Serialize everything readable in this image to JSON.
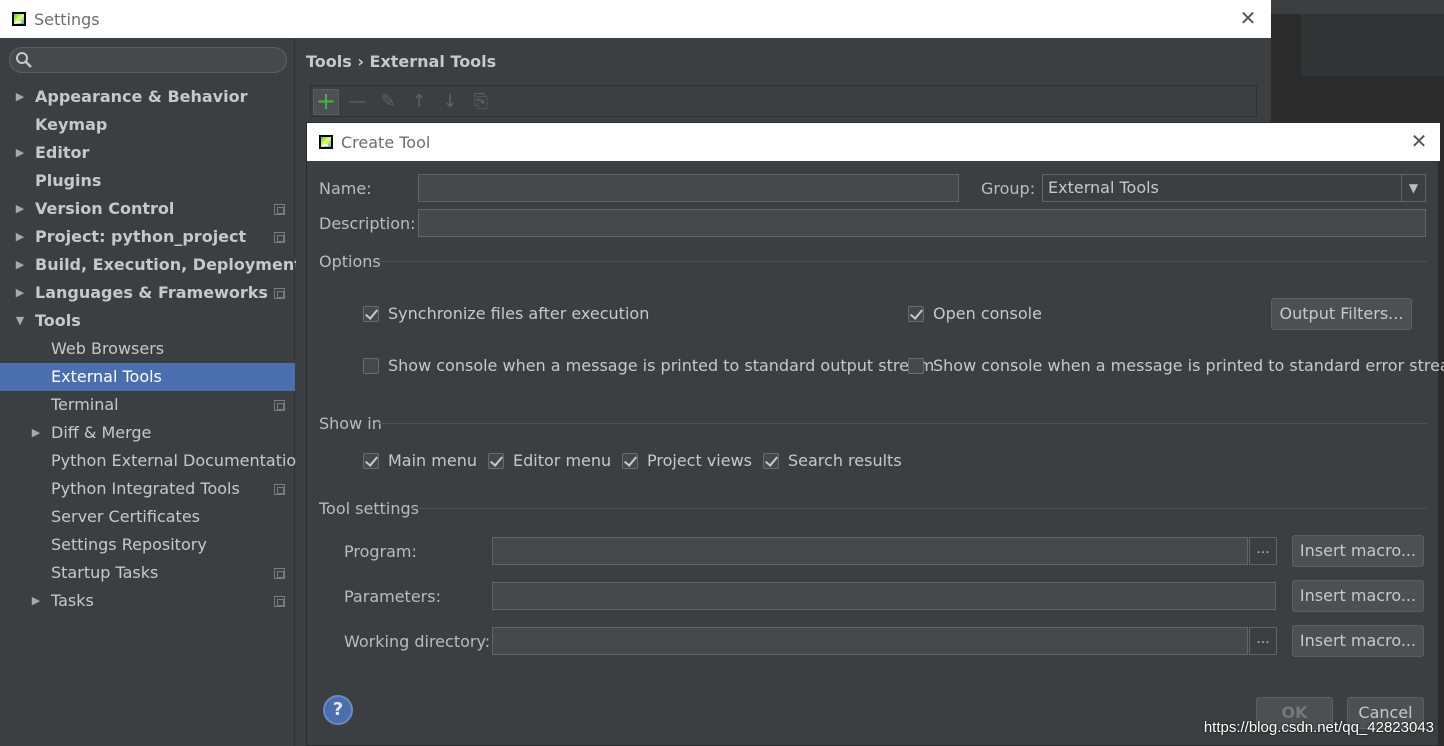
{
  "settings": {
    "title": "Settings",
    "breadcrumb": "Tools › External Tools",
    "sidebar": [
      {
        "label": "Appearance & Behavior",
        "bold": true,
        "arrow": "right",
        "level": 0,
        "icon": false
      },
      {
        "label": "Keymap",
        "bold": true,
        "arrow": "",
        "level": 0,
        "icon": false
      },
      {
        "label": "Editor",
        "bold": true,
        "arrow": "right",
        "level": 0,
        "icon": false
      },
      {
        "label": "Plugins",
        "bold": true,
        "arrow": "",
        "level": 0,
        "icon": false
      },
      {
        "label": "Version Control",
        "bold": true,
        "arrow": "right",
        "level": 0,
        "icon": true
      },
      {
        "label": "Project: python_project",
        "bold": true,
        "arrow": "right",
        "level": 0,
        "icon": true
      },
      {
        "label": "Build, Execution, Deployment",
        "bold": true,
        "arrow": "right",
        "level": 0,
        "icon": false
      },
      {
        "label": "Languages & Frameworks",
        "bold": true,
        "arrow": "right",
        "level": 0,
        "icon": true
      },
      {
        "label": "Tools",
        "bold": true,
        "arrow": "down",
        "level": 0,
        "icon": false
      },
      {
        "label": "Web Browsers",
        "bold": false,
        "arrow": "",
        "level": 1,
        "icon": false
      },
      {
        "label": "External Tools",
        "bold": false,
        "arrow": "",
        "level": 1,
        "icon": false,
        "selected": true
      },
      {
        "label": "Terminal",
        "bold": false,
        "arrow": "",
        "level": 1,
        "icon": true
      },
      {
        "label": "Diff & Merge",
        "bold": false,
        "arrow": "right",
        "level": 1,
        "icon": false
      },
      {
        "label": "Python External Documentation",
        "bold": false,
        "arrow": "",
        "level": 1,
        "icon": false
      },
      {
        "label": "Python Integrated Tools",
        "bold": false,
        "arrow": "",
        "level": 1,
        "icon": true
      },
      {
        "label": "Server Certificates",
        "bold": false,
        "arrow": "",
        "level": 1,
        "icon": false
      },
      {
        "label": "Settings Repository",
        "bold": false,
        "arrow": "",
        "level": 1,
        "icon": false
      },
      {
        "label": "Startup Tasks",
        "bold": false,
        "arrow": "",
        "level": 1,
        "icon": true
      },
      {
        "label": "Tasks",
        "bold": false,
        "arrow": "right",
        "level": 1,
        "icon": true
      }
    ]
  },
  "dialog": {
    "title": "Create Tool",
    "name_label": "Name:",
    "name_value": "",
    "group_label": "Group:",
    "group_value": "External Tools",
    "description_label": "Description:",
    "description_value": "",
    "options_title": "Options",
    "sync_files": "Synchronize files after execution",
    "open_console": "Open console",
    "output_filters": "Output Filters...",
    "show_console_stdout": "Show console when a message is printed to standard output stream",
    "show_console_stderr": "Show console when a message is printed to standard error stream",
    "show_in_title": "Show in",
    "main_menu": "Main menu",
    "editor_menu": "Editor menu",
    "project_views": "Project views",
    "search_results": "Search results",
    "tool_settings_title": "Tool settings",
    "program_label": "Program:",
    "parameters_label": "Parameters:",
    "working_dir_label": "Working directory:",
    "insert_macro": "Insert macro...",
    "ellipsis": "...",
    "ok": "OK",
    "cancel": "Cancel",
    "help": "?"
  },
  "watermark": "https://blog.csdn.net/qq_42823043",
  "colors": {
    "selection": "#4b6eaf",
    "add_icon": "#47b347",
    "background": "#3c3f41"
  }
}
